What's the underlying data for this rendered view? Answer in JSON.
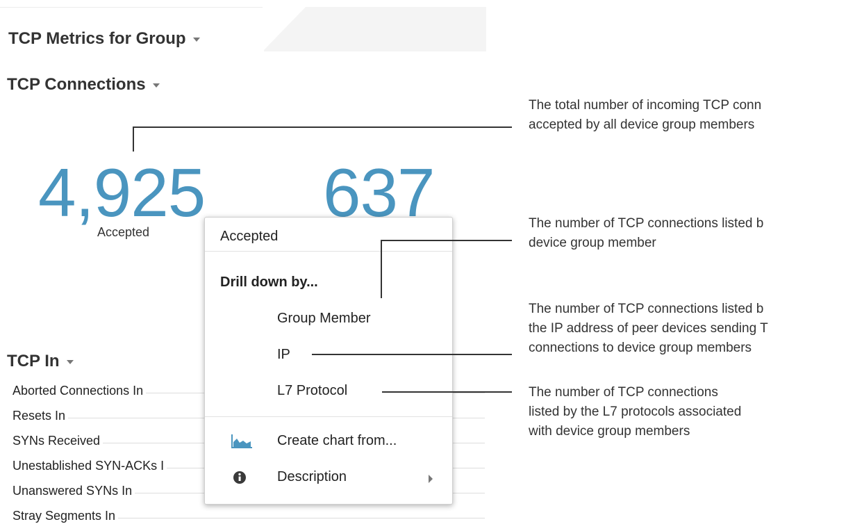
{
  "tab": {
    "title": "TCP Metrics for Group"
  },
  "connections": {
    "title": "TCP Connections",
    "accepted_value": "4,925",
    "accepted_label": "Accepted",
    "second_value": "637"
  },
  "tcp_in": {
    "title": "TCP In",
    "rows": [
      "Aborted Connections In",
      "Resets In",
      "SYNs Received",
      "Unestablished SYN-ACKs I",
      "Unanswered SYNs In",
      "Stray Segments In"
    ]
  },
  "menu": {
    "header": "Accepted",
    "drill_label": "Drill down by...",
    "items": [
      "Group Member",
      "IP",
      "L7 Protocol"
    ],
    "create_chart": "Create chart from...",
    "description": "Description"
  },
  "annotations": {
    "a1": [
      "The total number of incoming TCP conn",
      "accepted by all device group members"
    ],
    "a2": [
      "The number of TCP connections listed b",
      "device group member"
    ],
    "a3": [
      "The number of TCP connections listed b",
      "the IP address of peer devices sending T",
      "connections to device group members"
    ],
    "a4": [
      "The number of TCP connections",
      "listed by the L7 protocols associated",
      "with device group members"
    ]
  },
  "colors": {
    "accent": "#4a95bf",
    "text": "#333333"
  }
}
